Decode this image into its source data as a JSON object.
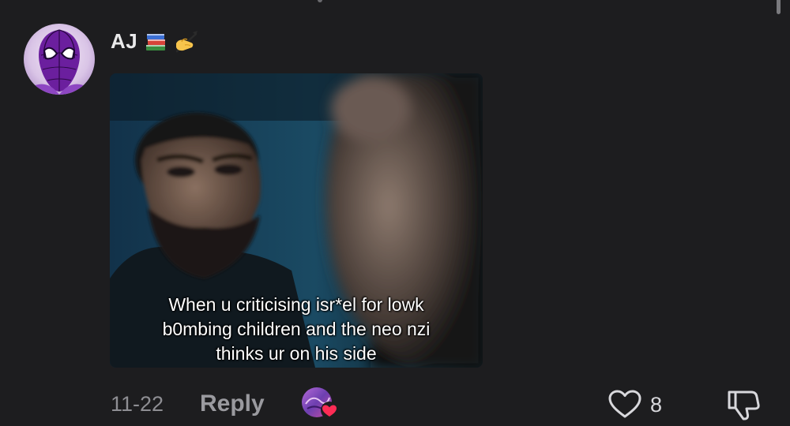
{
  "comment": {
    "username": "AJ",
    "username_emojis": [
      "books-emoji",
      "writing-hand-emoji"
    ],
    "avatar_icon": "purple-spider-hero-avatar",
    "media": {
      "caption_lines": [
        "When u criticising isr*el for lowk",
        "b0mbing children and the neo nzi",
        "thinks ur on his side"
      ]
    },
    "date": "11-22",
    "reply_label": "Reply",
    "creator_like_badge": "heart-badge-icon",
    "like_count": "8"
  },
  "icons": {
    "like": "heart-outline-icon",
    "dislike": "thumbs-down-icon"
  },
  "colors": {
    "background": "#1d1d1f",
    "secondary_text": "#8e8e93",
    "heart_badge": "#fe2c55"
  }
}
